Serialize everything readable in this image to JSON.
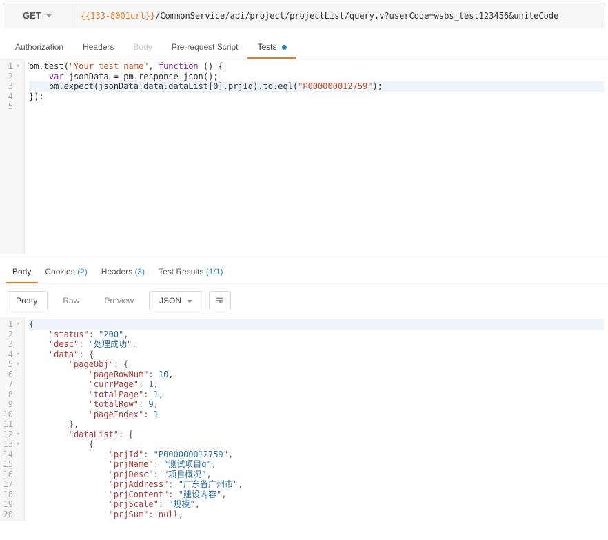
{
  "method": "GET",
  "url_variable": "{{133-8001url}}",
  "url_path": "/CommonService/api/project/projectList/query.v?userCode=wsbs_test123456&uniteCode",
  "req_tabs": {
    "auth": "Authorization",
    "headers": "Headers",
    "body": "Body",
    "prerequest": "Pre-request Script",
    "tests": "Tests"
  },
  "editor_lines": {
    "l1_a": "pm.test(",
    "l1_b": "\"Your test name\"",
    "l1_c": ", ",
    "l1_d": "function",
    "l1_e": " () {",
    "l2_a": "    ",
    "l2_b": "var",
    "l2_c": " jsonData = pm.response.json();",
    "l3_a": "    pm.expect(jsonData.data.dataList[0].prjId).to.eql(",
    "l3_b": "\"P000000012759\"",
    "l3_c": ");",
    "l4": "});"
  },
  "resp_tabs": {
    "body": "Body",
    "cookies": "Cookies",
    "cookies_count": "(2)",
    "headers": "Headers",
    "headers_count": "(3)",
    "testresults": "Test Results",
    "testresults_count": "(1/1)"
  },
  "toolbar": {
    "pretty": "Pretty",
    "raw": "Raw",
    "preview": "Preview",
    "format": "JSON"
  },
  "response_lines": [
    {
      "n": 1,
      "fold": true,
      "indent": 0,
      "raw": "{",
      "type": "punct"
    },
    {
      "n": 2,
      "indent": 1,
      "key": "status",
      "vstr": "200",
      "comma": true
    },
    {
      "n": 3,
      "indent": 1,
      "key": "desc",
      "vstr": "处理成功",
      "comma": true
    },
    {
      "n": 4,
      "fold": true,
      "indent": 1,
      "key": "data",
      "open": "{"
    },
    {
      "n": 5,
      "fold": true,
      "indent": 2,
      "key": "pageObj",
      "open": "{"
    },
    {
      "n": 6,
      "indent": 3,
      "key": "pageRowNum",
      "vnum": 10,
      "comma": true
    },
    {
      "n": 7,
      "indent": 3,
      "key": "currPage",
      "vnum": 1,
      "comma": true
    },
    {
      "n": 8,
      "indent": 3,
      "key": "totalPage",
      "vnum": 1,
      "comma": true
    },
    {
      "n": 9,
      "indent": 3,
      "key": "totalRow",
      "vnum": 9,
      "comma": true
    },
    {
      "n": 10,
      "indent": 3,
      "key": "pageIndex",
      "vnum": 1
    },
    {
      "n": 11,
      "indent": 2,
      "raw": "},",
      "type": "punct"
    },
    {
      "n": 12,
      "fold": true,
      "indent": 2,
      "key": "dataList",
      "open": "["
    },
    {
      "n": 13,
      "fold": true,
      "indent": 3,
      "raw": "{",
      "type": "punct"
    },
    {
      "n": 14,
      "indent": 4,
      "key": "prjId",
      "vstr": "P000000012759",
      "comma": true
    },
    {
      "n": 15,
      "indent": 4,
      "key": "prjName",
      "vstr": "测试项目q",
      "comma": true
    },
    {
      "n": 16,
      "indent": 4,
      "key": "prjDesc",
      "vstr": "项目概况",
      "comma": true
    },
    {
      "n": 17,
      "indent": 4,
      "key": "prjAddress",
      "vstr": "广东省广州市",
      "comma": true
    },
    {
      "n": 18,
      "indent": 4,
      "key": "prjContent",
      "vstr": "建设内容",
      "comma": true
    },
    {
      "n": 19,
      "indent": 4,
      "key": "prjScale",
      "vstr": "规模",
      "comma": true
    },
    {
      "n": 20,
      "indent": 4,
      "key": "prjSum",
      "vnull": true,
      "comma": true
    }
  ]
}
